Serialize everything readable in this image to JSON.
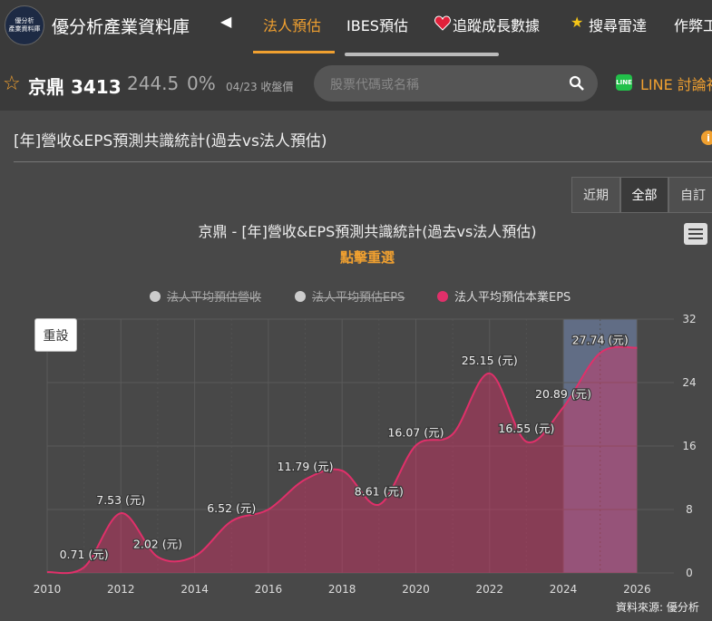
{
  "header": {
    "logo_text_1": "優分析",
    "logo_text_2": "產業資料庫",
    "brand": "優分析產業資料庫",
    "tabs": [
      {
        "label": "法人預估"
      },
      {
        "label": "IBES預估"
      },
      {
        "label": "追蹤成長數據"
      },
      {
        "label": "搜尋雷達"
      },
      {
        "label": "作弊工"
      }
    ]
  },
  "stock": {
    "name": "京鼎 3413",
    "price": "244.5",
    "change": "0%",
    "date": "04/23 收盤價"
  },
  "search": {
    "placeholder": "股票代碼或名稱"
  },
  "line_link": "LINE 討論社",
  "section": {
    "title": "[年]營收&EPS預測共識統計(過去vs法人預估)"
  },
  "range_buttons": [
    "近期",
    "全部",
    "自訂"
  ],
  "active_range": "全部",
  "colors": {
    "accent": "#f0a030",
    "series": "#e0306a",
    "forecast_band": "#6a7a9a"
  },
  "chart_data": {
    "type": "area",
    "title": "京鼎 - [年]營收&EPS預測共識統計(過去vs法人預估)",
    "subtitle": "點擊重選",
    "legend": [
      {
        "name": "法人平均預估營收",
        "visible": false
      },
      {
        "name": "法人平均預估EPS",
        "visible": false
      },
      {
        "name": "法人平均預估本業EPS",
        "visible": true
      }
    ],
    "x_ticks": [
      2010,
      2012,
      2014,
      2016,
      2018,
      2020,
      2022,
      2024,
      2026
    ],
    "y_ticks": [
      0,
      8,
      16,
      24,
      32
    ],
    "xlim": [
      2010,
      2027
    ],
    "ylim": [
      0,
      32
    ],
    "y_axis_side": "right",
    "grid": true,
    "forecast_band": [
      2024,
      2026
    ],
    "series": [
      {
        "name": "法人平均預估本業EPS",
        "x": [
          2010,
          2011,
          2012,
          2013,
          2014,
          2015,
          2016,
          2017,
          2018,
          2019,
          2020,
          2021,
          2022,
          2023,
          2024,
          2025,
          2026
        ],
        "values": [
          0.1,
          0.71,
          7.53,
          2.02,
          2.1,
          6.52,
          8.0,
          11.79,
          12.9,
          8.61,
          16.07,
          17.5,
          25.15,
          16.55,
          20.89,
          27.74,
          28.4
        ]
      }
    ],
    "labels": [
      {
        "x": 2011,
        "text": "0.71 (元)"
      },
      {
        "x": 2012,
        "text": "7.53 (元)"
      },
      {
        "x": 2013,
        "text": "2.02 (元)"
      },
      {
        "x": 2015,
        "text": "6.52 (元)"
      },
      {
        "x": 2017,
        "text": "11.79 (元)"
      },
      {
        "x": 2019,
        "text": "8.61 (元)"
      },
      {
        "x": 2020,
        "text": "16.07 (元)"
      },
      {
        "x": 2022,
        "text": "25.15 (元)"
      },
      {
        "x": 2023,
        "text": "16.55 (元)"
      },
      {
        "x": 2024,
        "text": "20.89 (元)"
      },
      {
        "x": 2025,
        "text": "27.74 (元)"
      }
    ],
    "reset_label": "重設",
    "credit": "資料來源: 優分析"
  }
}
